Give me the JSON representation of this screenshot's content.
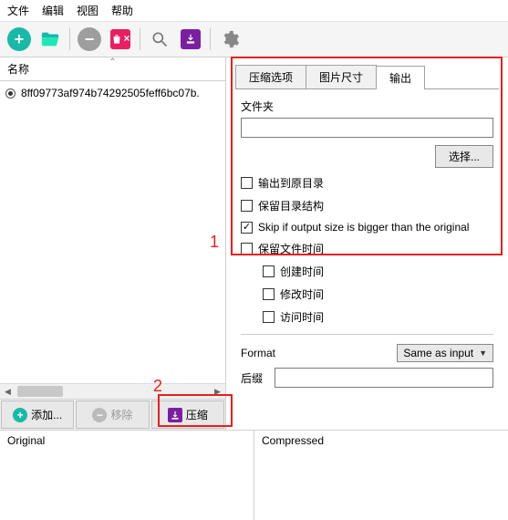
{
  "menu": {
    "file": "文件",
    "edit": "编辑",
    "view": "视图",
    "help": "帮助"
  },
  "left": {
    "col_name": "名称",
    "file_row": "8ff09773af974b74292505feff6bc07b.",
    "add": "添加...",
    "remove": "移除",
    "compress": "压缩"
  },
  "tabs": {
    "t1": "压缩选项",
    "t2": "图片尺寸",
    "t3": "输出"
  },
  "form": {
    "folder_label": "文件夹",
    "browse": "选择...",
    "out_to_src": "输出到原目录",
    "keep_struct": "保留目录结构",
    "skip_bigger": "Skip if output size is bigger than the original",
    "keep_time": "保留文件时间",
    "ctime": "创建时间",
    "mtime": "修改时间",
    "atime": "访问时间",
    "format": "Format",
    "format_val": "Same as input",
    "suffix": "后缀"
  },
  "preview": {
    "orig": "Original",
    "comp": "Compressed"
  },
  "ann": {
    "n1": "1",
    "n2": "2"
  }
}
